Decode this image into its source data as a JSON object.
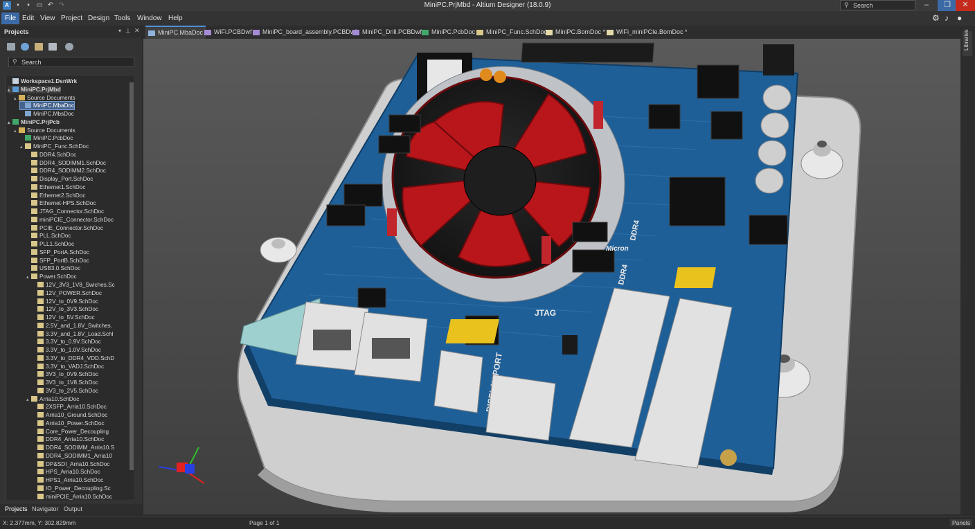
{
  "window": {
    "title": "MiniPC.PrjMbd - Altium Designer (18.0.9)",
    "search_placeholder": "Search",
    "buttons": [
      "–",
      "❐",
      "✕"
    ]
  },
  "menu": [
    "File",
    "Edit",
    "View",
    "Project",
    "Design",
    "Tools",
    "Window",
    "Help"
  ],
  "projects_panel": {
    "title": "Projects",
    "search_placeholder": "Search",
    "tree": [
      {
        "label": "Workspace1.DsnWrk",
        "level": 0,
        "icon": "workspace-icon",
        "bold": true
      },
      {
        "label": "MiniPC.PrjMbd",
        "level": 0,
        "icon": "project-icon",
        "bold": true,
        "toggle": "▴",
        "highlight": true
      },
      {
        "label": "Source Documents",
        "level": 1,
        "icon": "folder-icon",
        "toggle": "▴"
      },
      {
        "label": "MiniPC.MbaDoc",
        "level": 2,
        "icon": "mba-doc-icon",
        "selected": true
      },
      {
        "label": "MiniPC.MbsDoc",
        "level": 2,
        "icon": "mbs-doc-icon"
      },
      {
        "label": "MiniPC.PrjPcb",
        "level": 0,
        "icon": "pcb-project-icon",
        "bold": true,
        "toggle": "▴"
      },
      {
        "label": "Source Documents",
        "level": 1,
        "icon": "folder-icon",
        "toggle": "▴"
      },
      {
        "label": "MiniPC.PcbDoc",
        "level": 2,
        "icon": "pcb-doc-icon"
      },
      {
        "label": "MiniPC_Func.SchDoc",
        "level": 2,
        "icon": "schematic-icon",
        "toggle": "▴"
      },
      {
        "label": "DDR4.SchDoc",
        "level": 3,
        "icon": "schematic-icon"
      },
      {
        "label": "DDR4_SODIMM1.SchDoc",
        "level": 3,
        "icon": "schematic-icon"
      },
      {
        "label": "DDR4_SODIMM2.SchDoc",
        "level": 3,
        "icon": "schematic-icon"
      },
      {
        "label": "Display_Port.SchDoc",
        "level": 3,
        "icon": "schematic-icon"
      },
      {
        "label": "Ethernet1.SchDoc",
        "level": 3,
        "icon": "schematic-icon"
      },
      {
        "label": "Ethernet2.SchDoc",
        "level": 3,
        "icon": "schematic-icon"
      },
      {
        "label": "Ethernet-HPS.SchDoc",
        "level": 3,
        "icon": "schematic-icon"
      },
      {
        "label": "JTAG_Connector.SchDoc",
        "level": 3,
        "icon": "schematic-icon"
      },
      {
        "label": "miniPCIE_Connector.SchDoc",
        "level": 3,
        "icon": "schematic-icon"
      },
      {
        "label": "PCIE_Connector.SchDoc",
        "level": 3,
        "icon": "schematic-icon"
      },
      {
        "label": "PLL.SchDoc",
        "level": 3,
        "icon": "schematic-icon"
      },
      {
        "label": "PLL1.SchDoc",
        "level": 3,
        "icon": "schematic-icon"
      },
      {
        "label": "SFP_PortA.SchDoc",
        "level": 3,
        "icon": "schematic-icon"
      },
      {
        "label": "SFP_PortB.SchDoc",
        "level": 3,
        "icon": "schematic-icon"
      },
      {
        "label": "USB3.0.SchDoc",
        "level": 3,
        "icon": "schematic-icon"
      },
      {
        "label": "Power.SchDoc",
        "level": 3,
        "icon": "schematic-icon",
        "toggle": "▴"
      },
      {
        "label": "12V_3V3_1V8_Swiches.Sc",
        "level": 4,
        "icon": "schematic-icon"
      },
      {
        "label": "12V_POWER.SchDoc",
        "level": 4,
        "icon": "schematic-icon"
      },
      {
        "label": "12V_to_0V9.SchDoc",
        "level": 4,
        "icon": "schematic-icon"
      },
      {
        "label": "12V_to_3V3.SchDoc",
        "level": 4,
        "icon": "schematic-icon"
      },
      {
        "label": "12V_to_5V.SchDoc",
        "level": 4,
        "icon": "schematic-icon"
      },
      {
        "label": "2.5V_and_1.8V_Switches.",
        "level": 4,
        "icon": "schematic-icon"
      },
      {
        "label": "3.3V_and_1.8V_Load.Schl",
        "level": 4,
        "icon": "schematic-icon"
      },
      {
        "label": "3.3V_to_0.9V.SchDoc",
        "level": 4,
        "icon": "schematic-icon"
      },
      {
        "label": "3.3V_to_1.0V.SchDoc",
        "level": 4,
        "icon": "schematic-icon"
      },
      {
        "label": "3.3V_to_DDR4_VDD.SchD",
        "level": 4,
        "icon": "schematic-icon"
      },
      {
        "label": "3.3V_to_VADJ.SchDoc",
        "level": 4,
        "icon": "schematic-icon"
      },
      {
        "label": "3V3_to_0V9.SchDoc",
        "level": 4,
        "icon": "schematic-icon"
      },
      {
        "label": "3V3_to_1V8.SchDoc",
        "level": 4,
        "icon": "schematic-icon"
      },
      {
        "label": "3V3_to_2V5.SchDoc",
        "level": 4,
        "icon": "schematic-icon"
      },
      {
        "label": "Arria10.SchDoc",
        "level": 3,
        "icon": "schematic-icon",
        "toggle": "▴"
      },
      {
        "label": "2XSFP_Arria10.SchDoc",
        "level": 4,
        "icon": "schematic-icon"
      },
      {
        "label": "Arria10_Ground.SchDoc",
        "level": 4,
        "icon": "schematic-icon"
      },
      {
        "label": "Arria10_Power.SchDoc",
        "level": 4,
        "icon": "schematic-icon"
      },
      {
        "label": "Core_Power_Decoupling",
        "level": 4,
        "icon": "schematic-icon"
      },
      {
        "label": "DDR4_Arria10.SchDoc",
        "level": 4,
        "icon": "schematic-icon"
      },
      {
        "label": "DDR4_SODIMM_Arria10.S",
        "level": 4,
        "icon": "schematic-icon"
      },
      {
        "label": "DDR4_SODIMM1_Arria10",
        "level": 4,
        "icon": "schematic-icon"
      },
      {
        "label": "DP&SDI_Arria10.SchDoc",
        "level": 4,
        "icon": "schematic-icon"
      },
      {
        "label": "HPS_Arria10.SchDoc",
        "level": 4,
        "icon": "schematic-icon"
      },
      {
        "label": "HPS1_Arria10.SchDoc",
        "level": 4,
        "icon": "schematic-icon"
      },
      {
        "label": "IO_Power_Decoupling.Sc",
        "level": 4,
        "icon": "schematic-icon"
      },
      {
        "label": "miniPCIE_Arria10.SchDoc",
        "level": 4,
        "icon": "schematic-icon"
      }
    ],
    "bottom_tabs": [
      "Projects",
      "Navigator",
      "Output"
    ]
  },
  "doc_tabs": [
    {
      "label": "MiniPC.MbaDoc",
      "icon": "mba-doc-icon",
      "active": true
    },
    {
      "label": "WiFi.PCBDwf",
      "icon": "drawing-icon"
    },
    {
      "label": "MiniPC_board_assembly.PCBDwf",
      "icon": "drawing-icon"
    },
    {
      "label": "MiniPC_Drill.PCBDwf",
      "icon": "drawing-icon"
    },
    {
      "label": "MiniPC.PcbDoc",
      "icon": "pcb-doc-icon"
    },
    {
      "label": "MiniPC_Func.SchDoc",
      "icon": "schematic-icon"
    },
    {
      "label": "MiniPC.BomDoc *",
      "icon": "bom-doc-icon"
    },
    {
      "label": "WiFi_miniPCIe.BomDoc *",
      "icon": "bom-doc-icon"
    }
  ],
  "side_panel_label": "Libraries",
  "board_silkscreen": {
    "jtag": "JTAG",
    "display_port": "DISPLAY PORT",
    "ddr4_a": "DDR4",
    "ddr4_b": "DDR4",
    "micron": "Micron"
  },
  "status": {
    "coordinates": "X: 2.377mm, Y: 302.829mm",
    "page": "Page 1 of 1",
    "panels_button": "Panels"
  },
  "colors": {
    "accent": "#3c6aa6",
    "board_blue": "#1f5f97",
    "fan_red": "#b8161b",
    "close_red": "#c42b1c"
  }
}
